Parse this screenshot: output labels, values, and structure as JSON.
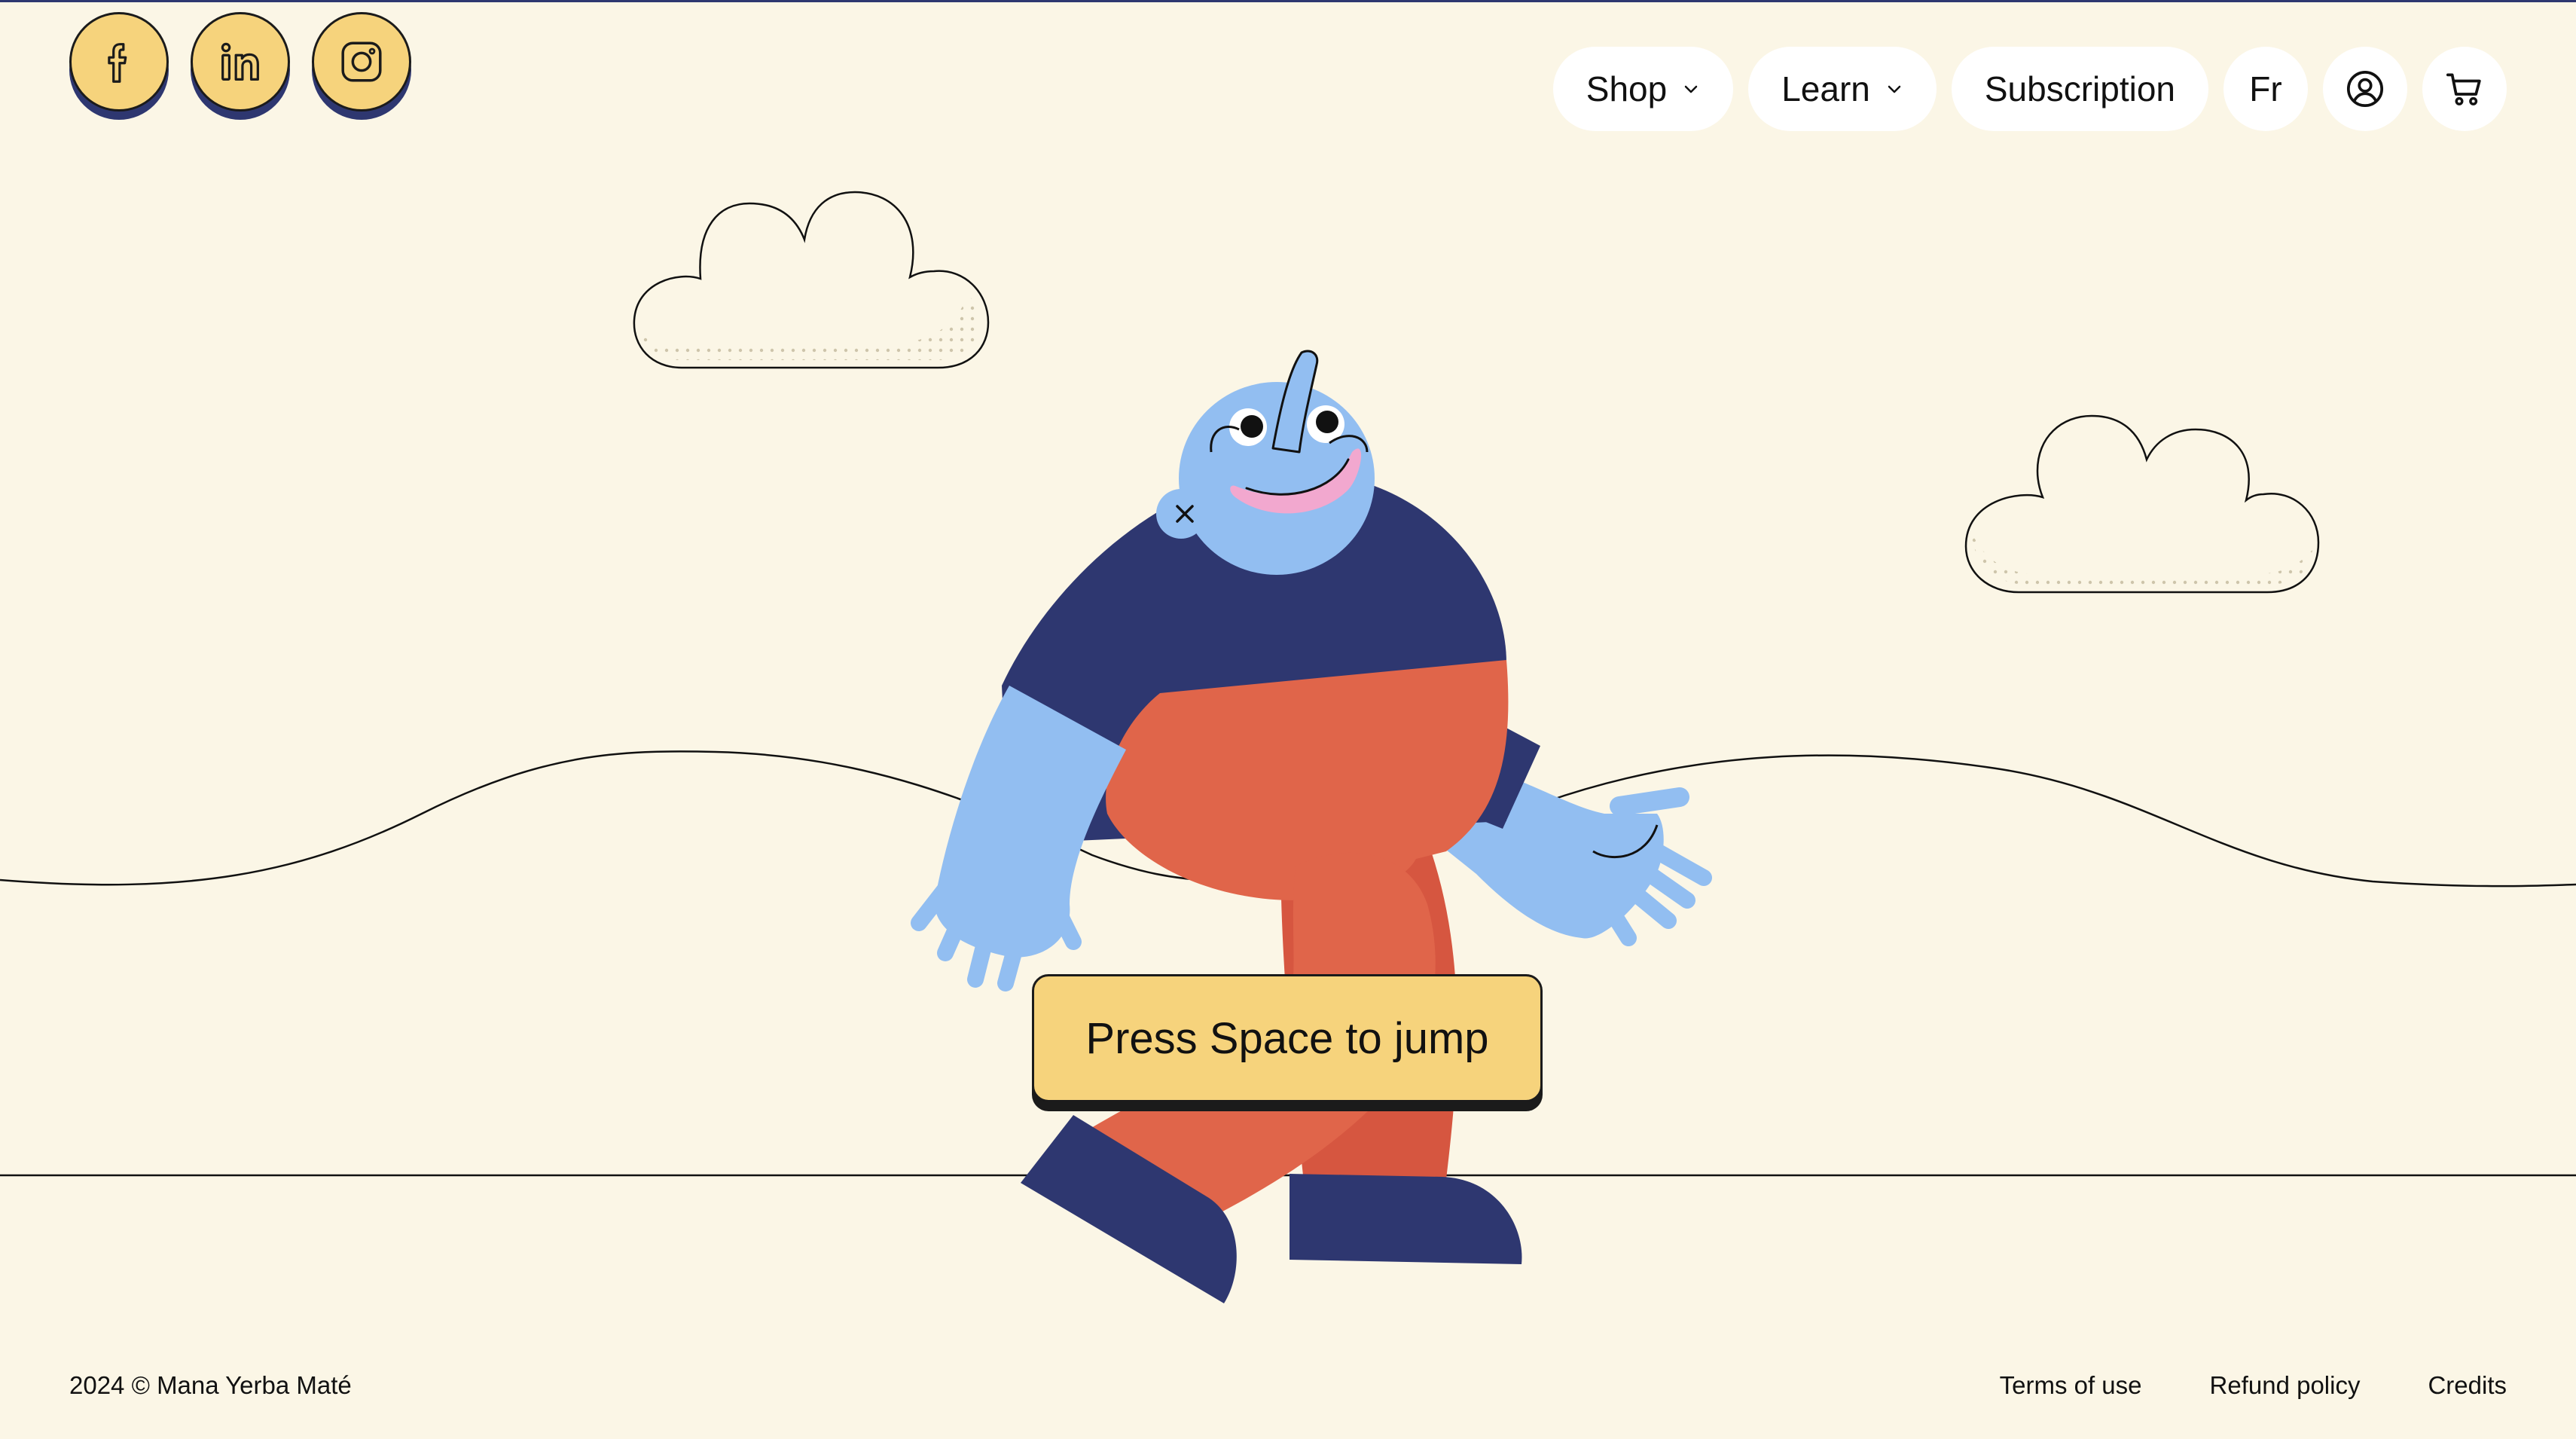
{
  "social": [
    {
      "name": "facebook",
      "icon": "facebook-icon"
    },
    {
      "name": "linkedin",
      "icon": "linkedin-icon"
    },
    {
      "name": "instagram",
      "icon": "instagram-icon"
    }
  ],
  "nav": {
    "shop_label": "Shop",
    "learn_label": "Learn",
    "subscription_label": "Subscription",
    "language_label": "Fr",
    "account_icon": "user-circle-icon",
    "cart_icon": "cart-icon"
  },
  "game": {
    "jump_prompt": "Press Space to jump",
    "character_shirt_color": "#2E3770",
    "character_skin_color": "#92BEF1",
    "character_pants_color": "#E0654A"
  },
  "footer": {
    "copyright": "2024 © Mana Yerba Maté",
    "terms_label": "Terms of use",
    "refund_label": "Refund policy",
    "credits_label": "Credits"
  },
  "colors": {
    "background": "#FBF6E6",
    "accent_yellow": "#F6D37C",
    "navy": "#2E3770"
  }
}
